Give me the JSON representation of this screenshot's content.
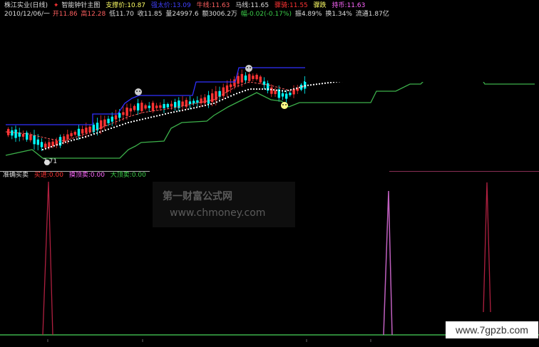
{
  "header": {
    "stock": "株江实业(日线)",
    "indicator": "智能钟针主图",
    "support": "支撑价:10.87",
    "item3": "强太价:13.09",
    "niu": "牛线:11.63",
    "ma": "马线:11.65",
    "item6": "骤骑:11.55",
    "item7": "骤跌",
    "chips": "持币:11.63"
  },
  "quote": {
    "date": "2010/12/06/一",
    "open": "开11.86",
    "high": "高12.28",
    "low": "低11.70",
    "close": "收11.85",
    "volume": "量24997.6",
    "amount": "额3006.2万",
    "change": "幅-0.02(-0.17%)",
    "amplitude": "振4.89%",
    "turnover": "换1.34%",
    "float": "流通1.87亿"
  },
  "sub": {
    "name": "准确买卖",
    "buy": "买进:0.00",
    "sell_label": "摸顶卖:0.00",
    "big_sell": "大顶卖:0.00"
  },
  "chart_labels": {
    "low_price": "7.71"
  },
  "watermark": {
    "line1": "第一财富公式网",
    "line2": "www.chmoney.com",
    "site": "www.7gpzb.com"
  },
  "colors": {
    "up": "#ff3333",
    "down": "#00ffff",
    "resistance": "#3030ff",
    "support": "#3cb04a",
    "dots": "#ffffff",
    "ma": "#ff6060",
    "spike_red": "#b02040",
    "spike_purple": "#c060c0"
  }
}
